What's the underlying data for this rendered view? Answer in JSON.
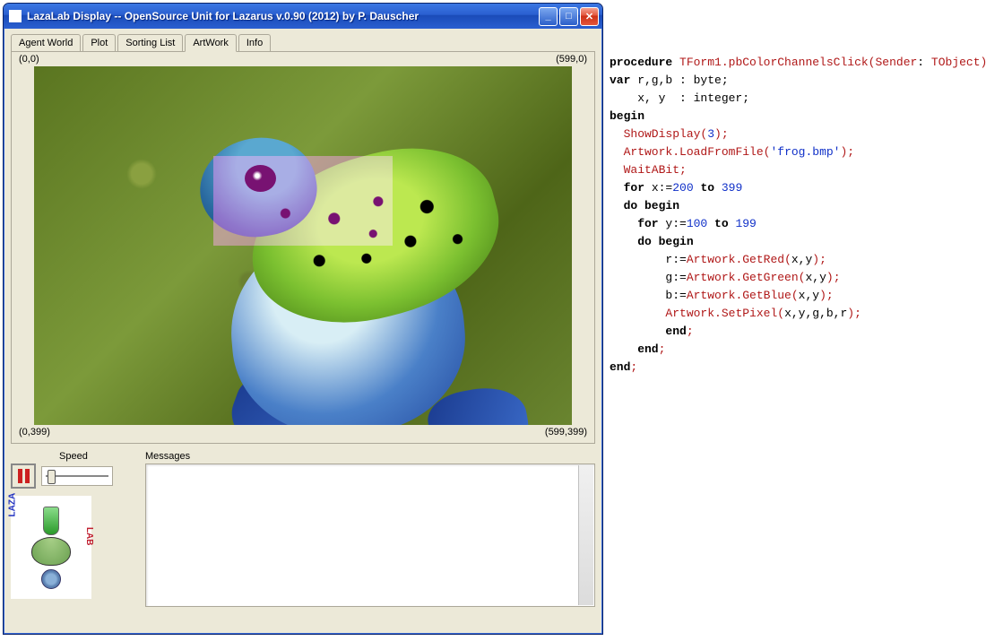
{
  "window": {
    "title": "LazaLab Display -- OpenSource Unit for Lazarus  v.0.90 (2012) by P. Dauscher"
  },
  "tabs": [
    {
      "label": "Agent World",
      "active": false
    },
    {
      "label": "Plot",
      "active": false
    },
    {
      "label": "Sorting List",
      "active": false
    },
    {
      "label": "ArtWork",
      "active": true
    },
    {
      "label": "Info",
      "active": false
    }
  ],
  "coords": {
    "tl": "(0,0)",
    "tr": "(599,0)",
    "bl": "(0,399)",
    "br": "(599,399)"
  },
  "panel": {
    "speed_label": "Speed",
    "messages_label": "Messages",
    "messages_text": ""
  },
  "logo": {
    "text_left": "LAZA",
    "text_right": "LAB"
  },
  "code": {
    "l1": {
      "kw1": "procedure",
      "id1": " TForm1",
      "d1": ".",
      "id2": "pbColorChannelsClick",
      "p1": "(",
      "id3": "Sender",
      "c1": ": ",
      "id4": "TObject",
      "p2": ")",
      "s": ";"
    },
    "l2": {
      "kw": "var",
      "t": " r,g,b : byte;"
    },
    "l3": {
      "t": "    x, y  : integer;"
    },
    "l4": {
      "kw": "begin"
    },
    "l5": {
      "id": "  ShowDisplay",
      "p1": "(",
      "n": "3",
      "p2": ")",
      "s": ";"
    },
    "l6": {
      "id": "  Artwork",
      "d": ".",
      "id2": "LoadFromFile",
      "p1": "(",
      "str": "'frog.bmp'",
      "p2": ")",
      "s": ";"
    },
    "l7": {
      "id": "  WaitABit",
      "s": ";"
    },
    "l8": {
      "kw1": "  for",
      "t": " x:=",
      "n1": "200",
      "kw2": " to ",
      "n2": "399"
    },
    "l9": {
      "kw": "  do begin"
    },
    "l10": {
      "kw1": "    for",
      "t": " y:=",
      "n1": "100",
      "kw2": " to ",
      "n2": "199"
    },
    "l11": {
      "kw": "    do begin"
    },
    "l12": {
      "t": "        r:=",
      "id": "Artwork",
      "d": ".",
      "id2": "GetRed",
      "p1": "(",
      "a": "x,y",
      "p2": ")",
      "s": ";"
    },
    "l13": {
      "t": "        g:=",
      "id": "Artwork",
      "d": ".",
      "id2": "GetGreen",
      "p1": "(",
      "a": "x,y",
      "p2": ")",
      "s": ";"
    },
    "l14": {
      "t": "        b:=",
      "id": "Artwork",
      "d": ".",
      "id2": "GetBlue",
      "p1": "(",
      "a": "x,y",
      "p2": ")",
      "s": ";"
    },
    "l15": {
      "t": "        ",
      "id": "Artwork",
      "d": ".",
      "id2": "SetPixel",
      "p1": "(",
      "a": "x,y,g,b,r",
      "p2": ")",
      "s": ";"
    },
    "l16": {
      "kw": "        end",
      "s": ";"
    },
    "l17": {
      "kw": "    end",
      "s": ";"
    },
    "l18": {
      "kw": "end",
      "s": ";"
    }
  }
}
